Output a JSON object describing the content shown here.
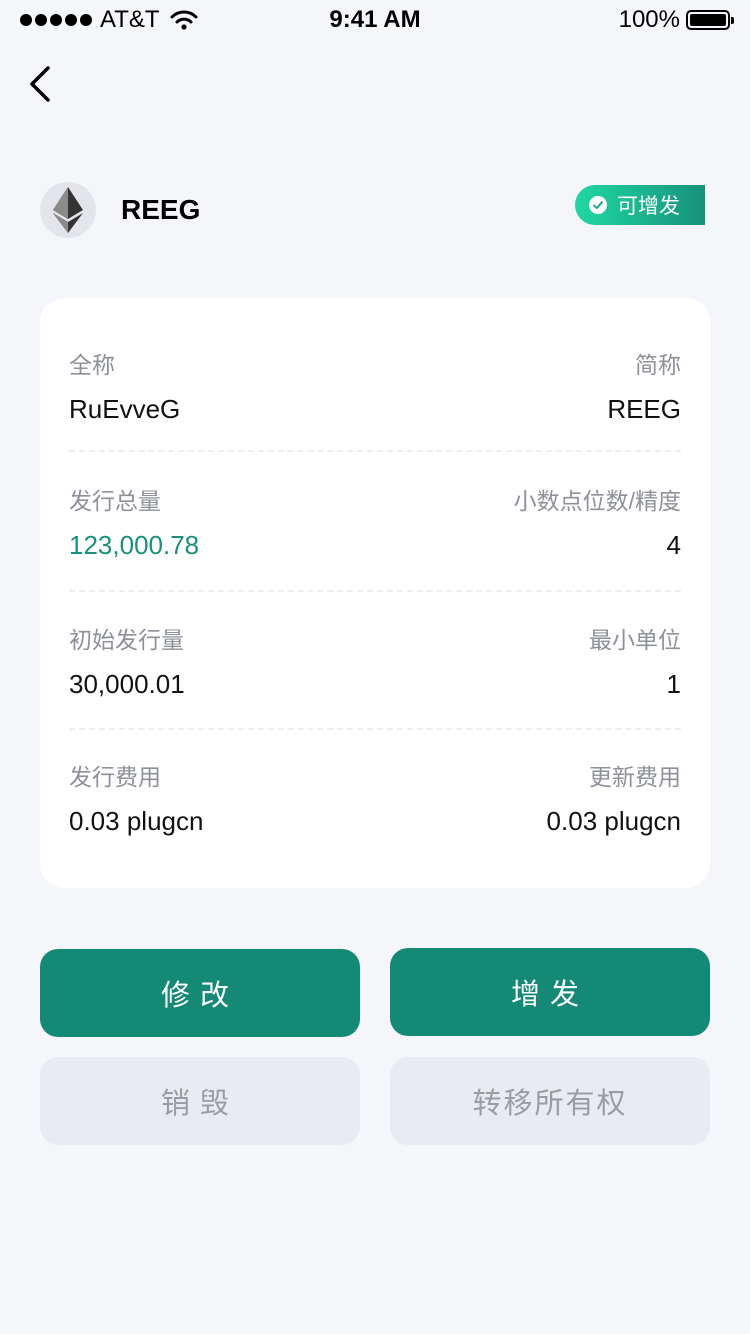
{
  "status_bar": {
    "carrier": "AT&T",
    "time": "9:41 AM",
    "battery": "100%"
  },
  "token": {
    "symbol": "REEG",
    "icon": "ethereum-icon",
    "badge": "可增发"
  },
  "details": {
    "full_name_label": "全称",
    "full_name_value": "RuEvveG",
    "short_name_label": "简称",
    "short_name_value": "REEG",
    "total_supply_label": "发行总量",
    "total_supply_value": "123,000.78",
    "decimals_label": "小数点位数/精度",
    "decimals_value": "4",
    "initial_supply_label": "初始发行量",
    "initial_supply_value": "30,000.01",
    "min_unit_label": "最小单位",
    "min_unit_value": "1",
    "issue_fee_label": "发行费用",
    "issue_fee_value": "0.03 plugcn",
    "update_fee_label": "更新费用",
    "update_fee_value": "0.03 plugcn"
  },
  "actions": {
    "edit": "修改",
    "mint": "增发",
    "burn": "销毁",
    "transfer_ownership": "转移所有权"
  },
  "colors": {
    "accent": "#148975",
    "badge_start": "#1fd8a3",
    "badge_end": "#17927c",
    "secondary_bg": "#e9ebf3"
  }
}
